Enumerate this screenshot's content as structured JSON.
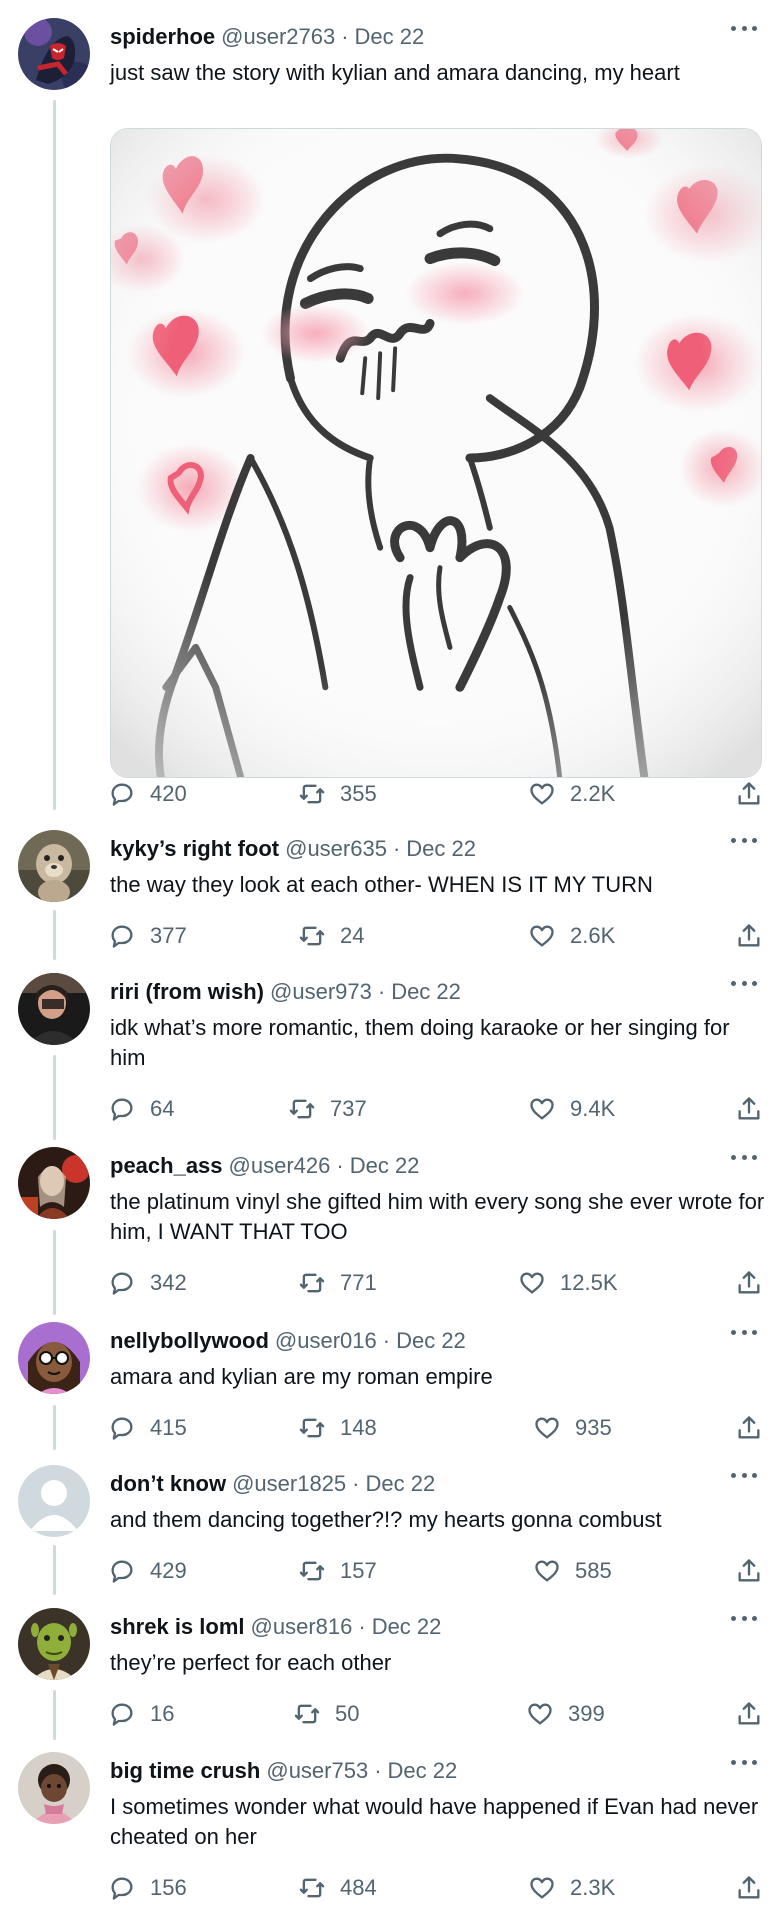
{
  "tweets": [
    {
      "name": "spiderhoe",
      "handle": "@user2763",
      "date": "Dec 22",
      "text": "just saw the story with kylian and amara dancing, my heart",
      "replies": "420",
      "retweets": "355",
      "likes": "2.2K",
      "avatar": "spiderman-avatar"
    },
    {
      "name": "kyky’s right foot",
      "handle": "@user635",
      "date": "Dec 22",
      "text": "the way they look at each other- WHEN IS IT MY TURN",
      "replies": "377",
      "retweets": "24",
      "likes": "2.6K",
      "avatar": "animal-avatar"
    },
    {
      "name": "riri (from wish)",
      "handle": "@user973",
      "date": "Dec 22",
      "text": "idk what’s more romantic, them doing karaoke or her singing for him",
      "replies": "64",
      "retweets": "737",
      "likes": "9.4K",
      "avatar": "person-avatar"
    },
    {
      "name": "peach_ass",
      "handle": "@user426",
      "date": "Dec 22",
      "text": "the platinum vinyl she gifted him with every song she ever wrote for him, I WANT THAT TOO",
      "replies": "342",
      "retweets": "771",
      "likes": "12.5K",
      "avatar": "person-avatar"
    },
    {
      "name": "nellybollywood",
      "handle": "@user016",
      "date": "Dec 22",
      "text": "amara and kylian are my roman empire",
      "replies": "415",
      "retweets": "148",
      "likes": "935",
      "avatar": "cartoon-avatar"
    },
    {
      "name": "don’t know",
      "handle": "@user1825",
      "date": "Dec 22",
      "text": "and them dancing together?!? my hearts gonna combust",
      "replies": "429",
      "retweets": "157",
      "likes": "585",
      "avatar": "default-avatar"
    },
    {
      "name": "shrek is loml",
      "handle": "@user816",
      "date": "Dec 22",
      "text": "they’re perfect for each other",
      "replies": "16",
      "retweets": "50",
      "likes": "399",
      "avatar": "shrek-avatar"
    },
    {
      "name": "big time crush",
      "handle": "@user753",
      "date": "Dec 22",
      "text": "I sometimes wonder what would have happened if Evan had never cheated on her",
      "replies": "156",
      "retweets": "484",
      "likes": "2.3K",
      "avatar": "child-avatar"
    }
  ],
  "colors": {
    "text": "#0f1419",
    "secondary": "#536471",
    "border": "#cfd9de",
    "heart_pink": "#f06a7f"
  },
  "icons": {
    "reply": "speech-bubble-icon",
    "retweet": "retweet-arrows-icon",
    "like": "heart-outline-icon",
    "share": "share-upload-icon",
    "more": "ellipsis-icon"
  }
}
